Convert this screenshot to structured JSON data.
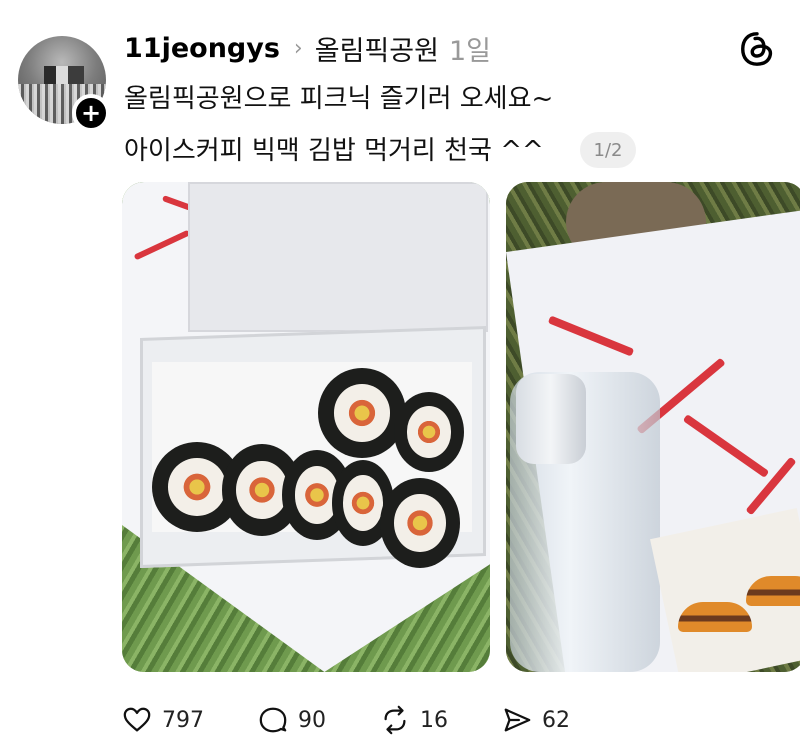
{
  "post": {
    "author": "11jeongys",
    "community": "올림픽공원",
    "time_ago": "1일",
    "text_line1": "올림픽공원으로 피크닉 즐기러 오세요~",
    "text_line2": "아이스커피 빅맥 김밥 먹거리 천국 ^^",
    "media_indicator": "1/2"
  },
  "icons": {
    "follow": "plus-icon",
    "brand": "threads-logo-icon",
    "separator": "chevron-right-icon",
    "like": "heart-icon",
    "reply": "comment-icon",
    "repost": "repost-icon",
    "share": "send-icon"
  },
  "actions": {
    "likes": "797",
    "replies": "90",
    "reposts": "16",
    "shares": "62"
  }
}
